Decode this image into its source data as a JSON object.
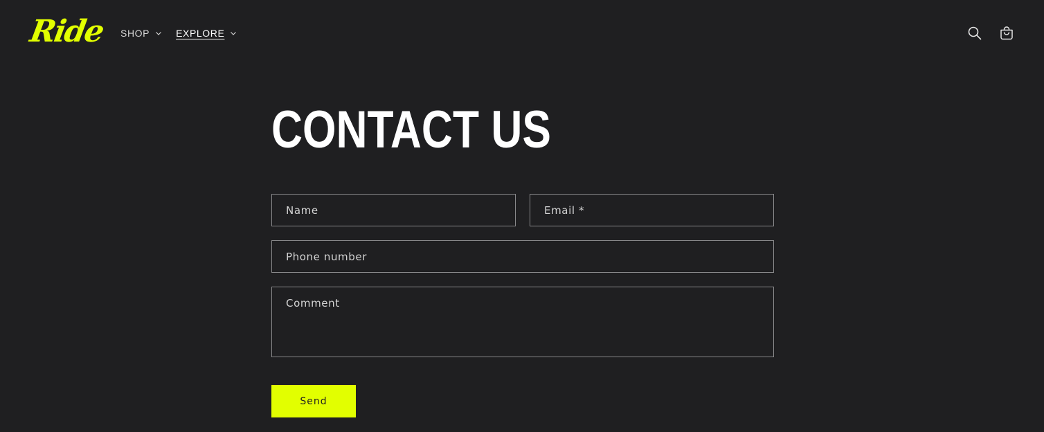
{
  "brand": {
    "logo_text": "Ride",
    "accent_color": "#e2ff00",
    "background_color": "#1f1f21"
  },
  "nav": {
    "items": [
      {
        "label": "SHOP",
        "active": false,
        "icon": "chevron-down-icon"
      },
      {
        "label": "EXPLORE",
        "active": true,
        "icon": "chevron-down-icon"
      }
    ]
  },
  "header_icons": {
    "search": "search-icon",
    "cart": "cart-icon"
  },
  "page": {
    "title": "CONTACT US"
  },
  "form": {
    "name_placeholder": "Name",
    "email_placeholder": "Email *",
    "phone_placeholder": "Phone number",
    "comment_placeholder": "Comment",
    "submit_label": "Send"
  }
}
